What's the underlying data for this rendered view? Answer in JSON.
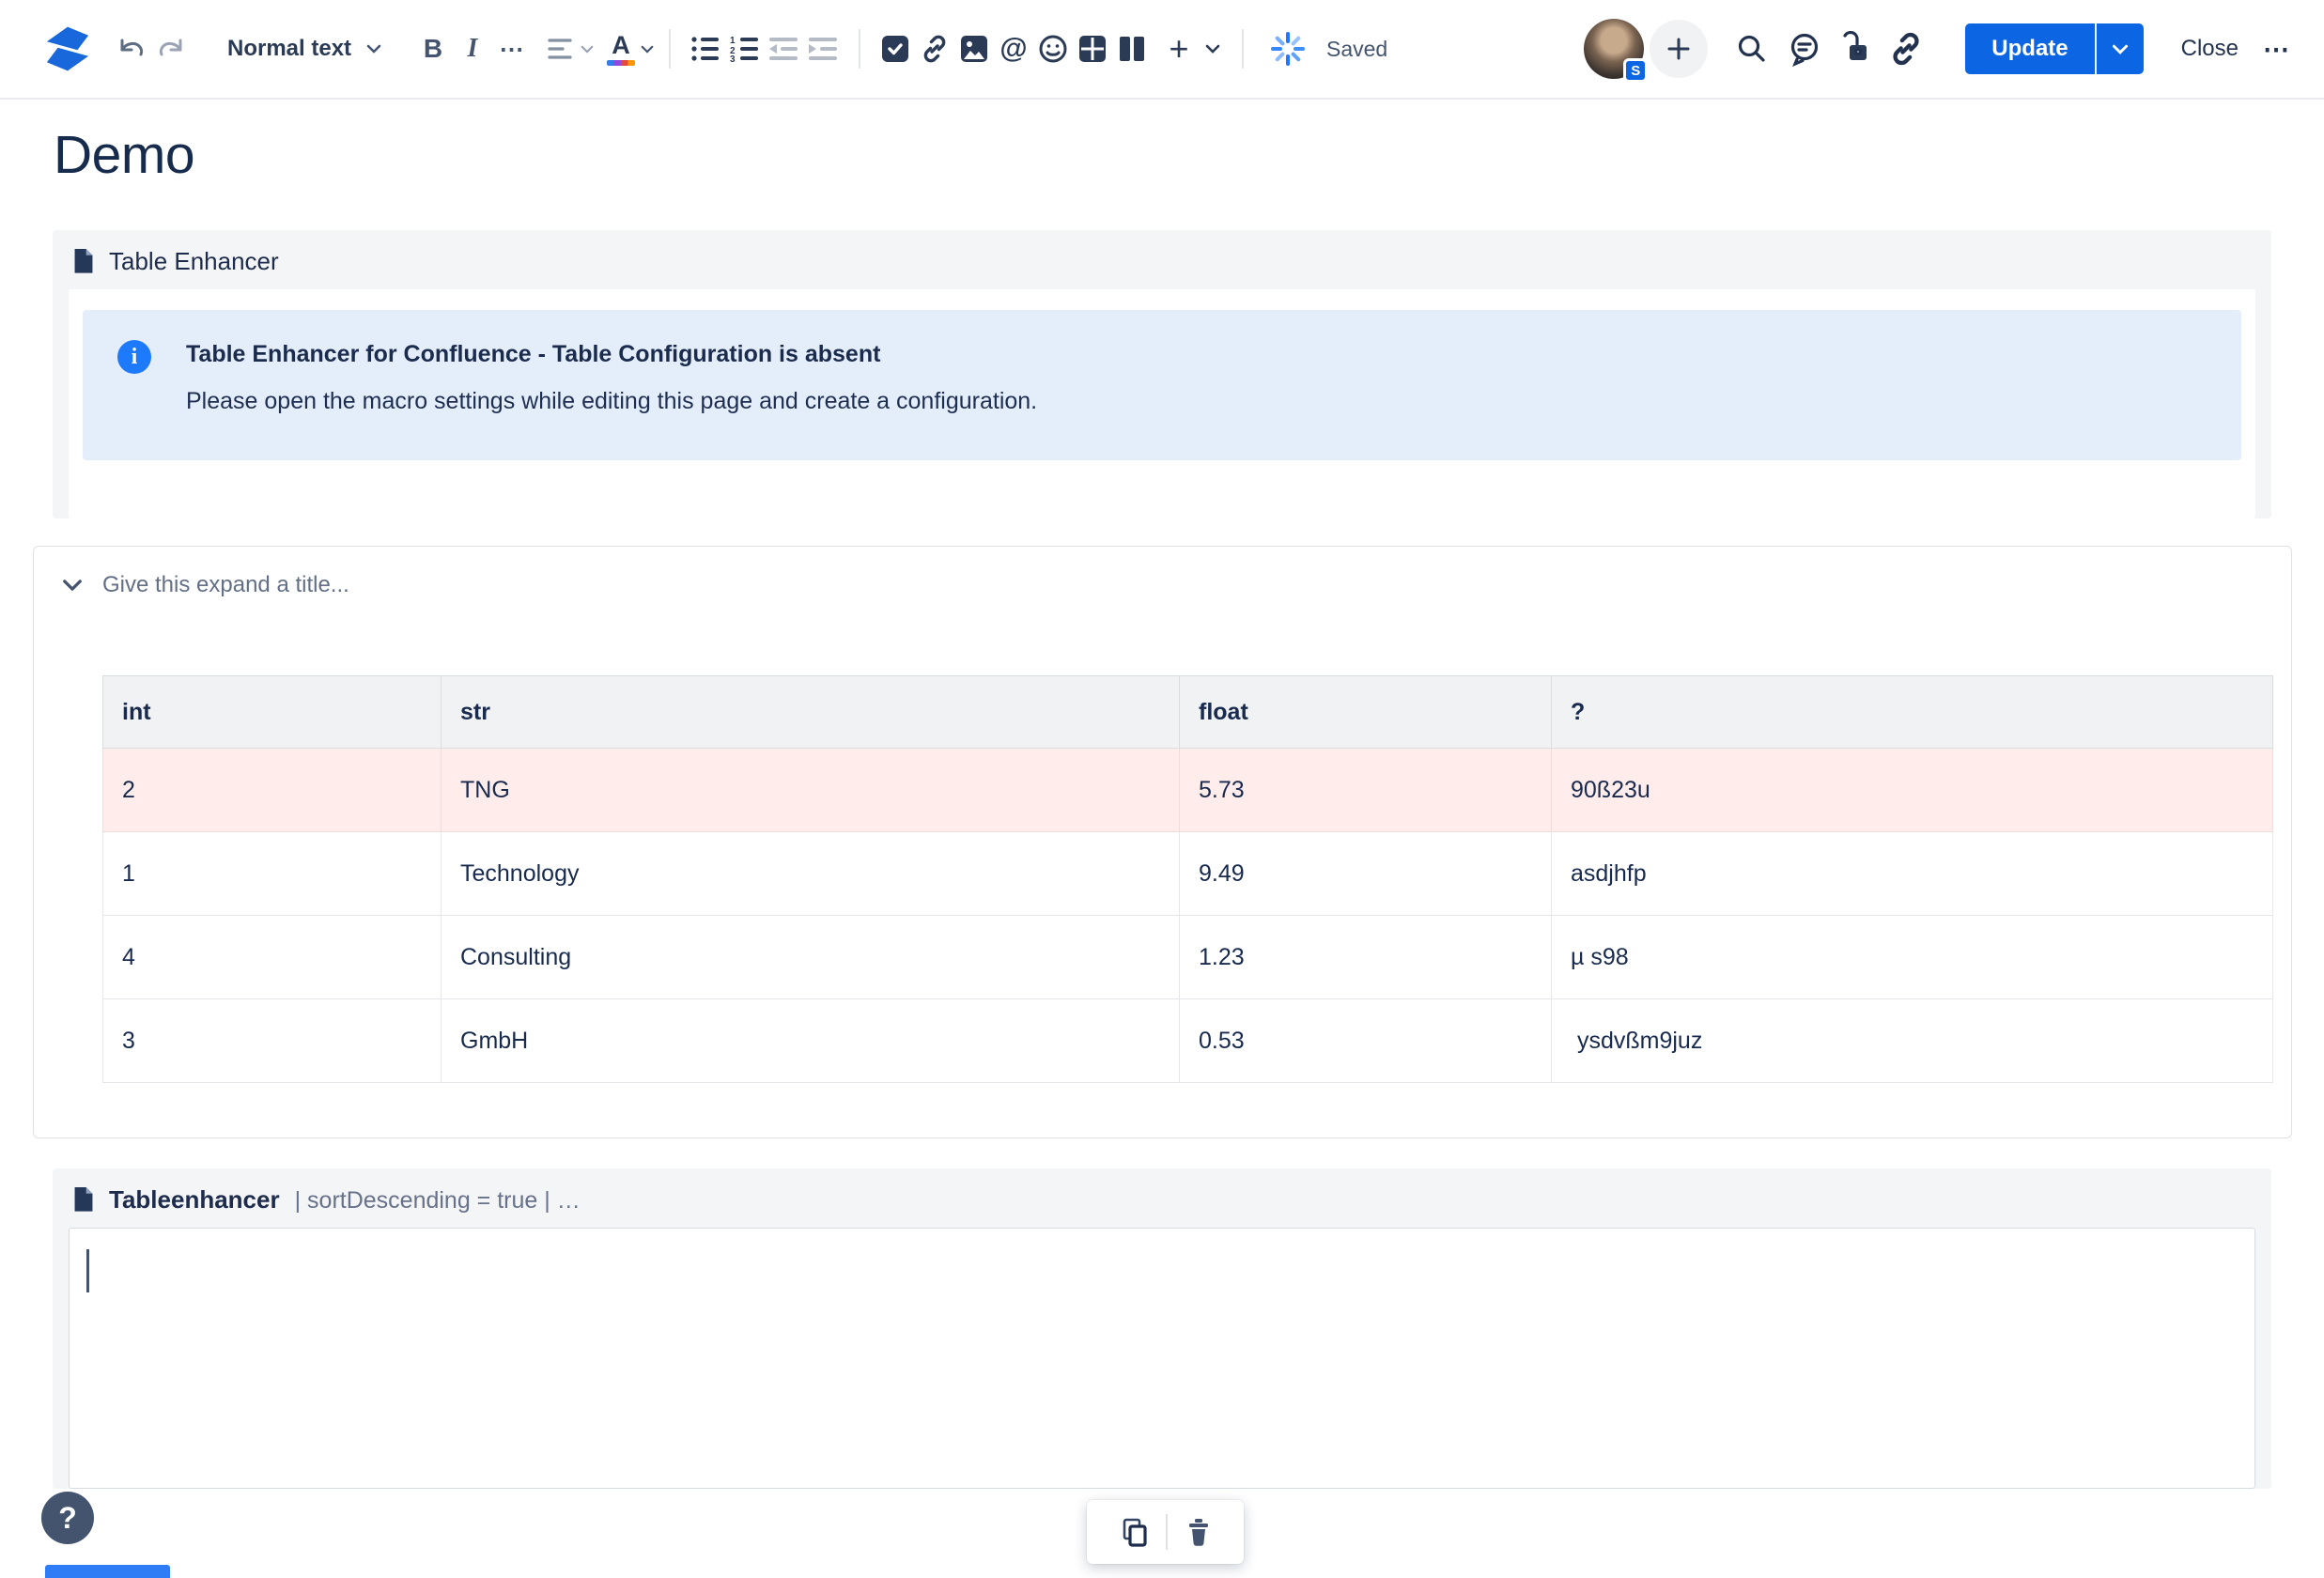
{
  "toolbar": {
    "style_label": "Normal text",
    "bold_glyph": "B",
    "italic_glyph": "I",
    "more_formatting_glyph": "⋯",
    "mention_glyph": "@",
    "insert_plus_glyph": "+",
    "saved_label": "Saved",
    "avatar_badge": "S",
    "update_label": "Update",
    "close_label": "Close",
    "overflow_glyph": "⋯"
  },
  "page": {
    "title": "Demo"
  },
  "macro_table_enhancer": {
    "title": "Table Enhancer",
    "info": {
      "title": "Table Enhancer for Confluence - Table Configuration is absent",
      "body": "Please open the macro settings while editing this page and create a configuration."
    }
  },
  "expand": {
    "placeholder": "Give this expand a title...",
    "table": {
      "headers": [
        "int",
        "str",
        "float",
        "?"
      ],
      "rows": [
        {
          "cells": [
            "2",
            "TNG",
            "5.73",
            "90ß23u"
          ],
          "highlight": true
        },
        {
          "cells": [
            "1",
            "Technology",
            "9.49",
            "asdjhfp"
          ],
          "highlight": false
        },
        {
          "cells": [
            "4",
            "Consulting",
            "1.23",
            "µ s98"
          ],
          "highlight": false
        },
        {
          "cells": [
            "3",
            "GmbH",
            "0.53",
            " ysdvßm9juz"
          ],
          "highlight": false
        }
      ]
    }
  },
  "macro_tableenhancer": {
    "title": "Tableenhancer",
    "params": "| sortDescending = true | …"
  },
  "help": {
    "label": "?"
  },
  "colors": {
    "primary_blue": "#0C66E4",
    "info_panel_bg": "#E4EEFB",
    "info_icon_blue": "#1D7AFC",
    "highlight_row_pink": "#FFECEB",
    "macro_panel_gray": "#F4F5F7",
    "text_navy": "#172B4D",
    "muted_gray": "#626F86"
  }
}
